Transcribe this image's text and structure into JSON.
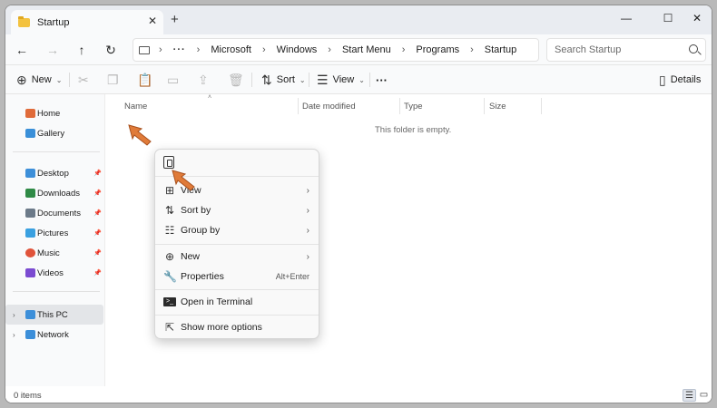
{
  "window": {
    "tab_title": "Startup",
    "tab_close": "✕",
    "tab_add": "+",
    "controls": {
      "minimize": "—",
      "maximize": "☐",
      "close": "✕"
    }
  },
  "address": {
    "breadcrumb": [
      "Microsoft",
      "Windows",
      "Start Menu",
      "Programs",
      "Startup"
    ],
    "more": "···",
    "search_placeholder": "Search Startup"
  },
  "toolbar": {
    "new_label": "New",
    "sort_label": "Sort",
    "view_label": "View",
    "more_label": "···",
    "details_label": "Details"
  },
  "sidebar": {
    "quick": [
      {
        "label": "Home",
        "color": "#e06b3a"
      },
      {
        "label": "Gallery",
        "color": "#3a8fd8"
      }
    ],
    "pinned": [
      {
        "label": "Desktop",
        "color": "#3d8fd9"
      },
      {
        "label": "Downloads",
        "color": "#2f8a46"
      },
      {
        "label": "Documents",
        "color": "#6c7a89"
      },
      {
        "label": "Pictures",
        "color": "#3aa0e0"
      },
      {
        "label": "Music",
        "color": "#e0533a"
      },
      {
        "label": "Videos",
        "color": "#7b4bd1"
      }
    ],
    "devices": [
      {
        "label": "This PC",
        "color": "#3d8fd9"
      },
      {
        "label": "Network",
        "color": "#3d8fd9"
      }
    ]
  },
  "columns": {
    "name": "Name",
    "date": "Date modified",
    "type": "Type",
    "size": "Size"
  },
  "empty_message": "This folder is empty.",
  "status": {
    "item_count": "0 items"
  },
  "context_menu": {
    "items": [
      {
        "label": "View",
        "icon": "grid-icon",
        "submenu": true
      },
      {
        "label": "Sort by",
        "icon": "sort-icon",
        "submenu": true
      },
      {
        "label": "Group by",
        "icon": "group-icon",
        "submenu": true
      },
      {
        "label": "New",
        "icon": "plus-circle-icon",
        "submenu": true
      },
      {
        "label": "Properties",
        "icon": "wrench-icon",
        "shortcut": "Alt+Enter"
      },
      {
        "label": "Open in Terminal",
        "icon": "terminal-icon"
      },
      {
        "label": "Show more options",
        "icon": "share-icon"
      }
    ]
  },
  "colors": {
    "cursor": "#e07b39",
    "folder": "#f3c23f"
  }
}
